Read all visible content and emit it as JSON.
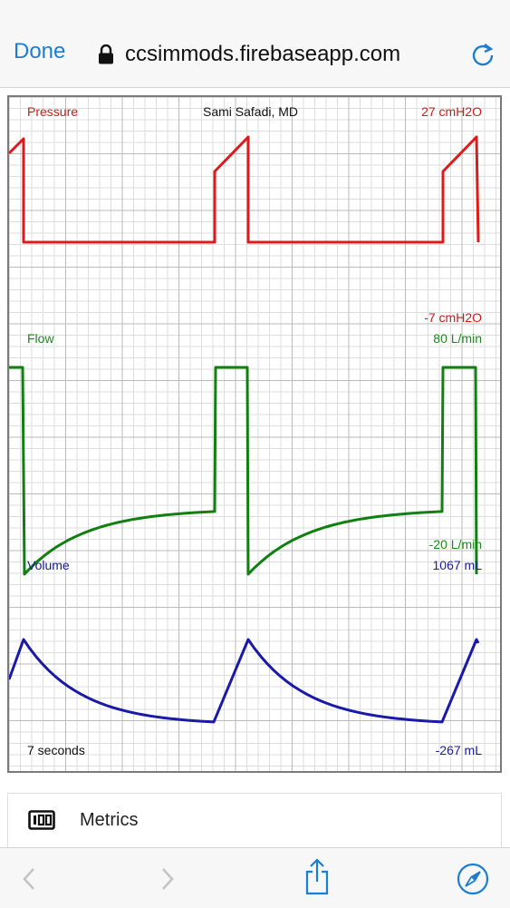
{
  "browser": {
    "done_label": "Done",
    "url": "ccsimmods.firebaseapp.com"
  },
  "monitor": {
    "author": "Sami Safadi, MD",
    "pressure": {
      "label": "Pressure",
      "max": "27 cmH2O",
      "min": "-7 cmH2O",
      "color": "#dd1b1b"
    },
    "flow": {
      "label": "Flow",
      "max": "80 L/min",
      "min": "-20 L/min",
      "color": "#118011"
    },
    "volume": {
      "label": "Volume",
      "max": "1067 mL",
      "min": "-267 mL",
      "color": "#1a1aa8"
    },
    "time_window": "7 seconds"
  },
  "metrics": {
    "label": "Metrics"
  },
  "icons": [
    "lock-icon",
    "reload-icon",
    "metrics-icon",
    "back-icon",
    "forward-icon",
    "share-icon",
    "compass-icon"
  ]
}
